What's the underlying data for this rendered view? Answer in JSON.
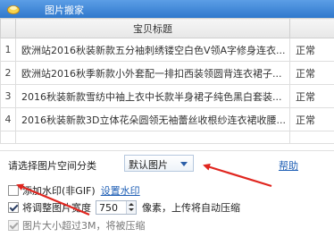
{
  "window": {
    "title": "图片搬家"
  },
  "table": {
    "header": "宝贝标题",
    "rows": [
      {
        "index": "1",
        "title": "欧洲站2016秋装新款五分袖刺绣镂空白色V领A字修身连衣...",
        "status": "正常"
      },
      {
        "index": "2",
        "title": "欧洲站2016秋季新款小外套配一排扣西装领圆背连衣裙子...",
        "status": "正常"
      },
      {
        "index": "3",
        "title": "2016秋装新款雪纺中袖上衣中长款半身裙子纯色黑白套装...",
        "status": "正常"
      },
      {
        "index": "4",
        "title": "2016秋装新款3D立体花朵圆领无袖蕾丝收根纱连衣裙收腰...",
        "status": "正常"
      }
    ]
  },
  "options": {
    "category_label": "请选择图片空间分类",
    "category_value": "默认图片",
    "help": "帮助",
    "watermark_label": "添加水印(非GIF)",
    "watermark_link": "设置水印",
    "resize_label": "将调整图片宽度",
    "resize_value": "750",
    "resize_suffix": "像素，上传将自动压缩",
    "oversize_label": "图片大小超过3M，将被压缩"
  },
  "colors": {
    "titlebar": "#3f86d6",
    "arrow": "#e0261f",
    "link": "#1f5fb5"
  }
}
